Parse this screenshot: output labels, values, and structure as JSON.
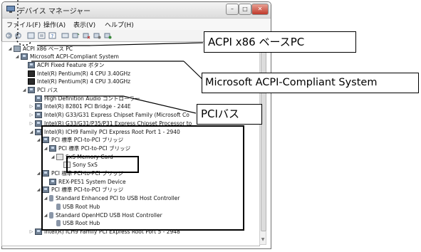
{
  "window": {
    "title": "デバイス マネージャー",
    "controls": {
      "minimize": "–",
      "maximize": "□",
      "close": "✕"
    }
  },
  "menu": {
    "items": [
      "ファイル(F)",
      "操作(A)",
      "表示(V)",
      "ヘルプ(H)"
    ]
  },
  "toolbar": {
    "icons": [
      "back-icon",
      "forward-icon",
      "view-icon",
      "properties-icon",
      "help-icon",
      "scan-icon",
      "update-driver-icon",
      "uninstall-icon",
      "disable-icon",
      "enable-icon"
    ]
  },
  "tree": {
    "nodes": [
      {
        "label": "ACPI x86 ベース PC",
        "indent": 0,
        "expander": "◢",
        "icon": "computer-icon"
      },
      {
        "label": "Microsoft ACPI-Compliant System",
        "indent": 1,
        "expander": "◢",
        "icon": "device-icon"
      },
      {
        "label": "ACPI Fixed Feature ボタン",
        "indent": 2,
        "expander": "",
        "icon": "device-icon"
      },
      {
        "label": "Intel(R) Pentium(R) 4 CPU 3.40GHz",
        "indent": 2,
        "expander": "",
        "icon": "cpu-icon"
      },
      {
        "label": "Intel(R) Pentium(R) 4 CPU 3.40GHz",
        "indent": 2,
        "expander": "",
        "icon": "cpu-icon"
      },
      {
        "label": "PCI バス",
        "indent": 2,
        "expander": "◢",
        "icon": "device-icon"
      },
      {
        "label": "High Definition Audio コントローラー",
        "indent": 3,
        "expander": "",
        "icon": "device-icon"
      },
      {
        "label": "Intel(R) 82801 PCI Bridge - 244E",
        "indent": 3,
        "expander": "▷",
        "icon": "device-icon"
      },
      {
        "label": "Intel(R) G33/G31 Express Chipset Family (Microsoft Co",
        "indent": 3,
        "expander": "▷",
        "icon": "device-icon"
      },
      {
        "label": "Intel(R) G33/G31/P35/P31 Express Chipset Processor to",
        "indent": 3,
        "expander": "▷",
        "icon": "device-icon"
      },
      {
        "label": "Intel(R) ICH9 Family PCI Express Root Port 1 - 2940",
        "indent": 3,
        "expander": "◢",
        "icon": "device-icon"
      },
      {
        "label": "PCI 標準 PCI-to-PCI ブリッジ",
        "indent": 4,
        "expander": "◢",
        "icon": "device-icon"
      },
      {
        "label": "PCI 標準 PCI-to-PCI ブリッジ",
        "indent": 5,
        "expander": "◢",
        "icon": "device-icon"
      },
      {
        "label": "SxS Memory Card",
        "indent": 6,
        "expander": "◢",
        "icon": "card-icon"
      },
      {
        "label": "Sony SxS",
        "indent": 7,
        "expander": "",
        "icon": "card-icon"
      },
      {
        "label": "PCI 標準 PCI-to-PCI ブリッジ",
        "indent": 4,
        "expander": "◢",
        "icon": "device-icon"
      },
      {
        "label": "REX-PE51 System Device",
        "indent": 5,
        "expander": "",
        "icon": "device-icon"
      },
      {
        "label": "PCI 標準 PCI-to-PCI ブリッジ",
        "indent": 4,
        "expander": "◢",
        "icon": "device-icon"
      },
      {
        "label": "Standard Enhanced PCI to USB Host Controller",
        "indent": 5,
        "expander": "◢",
        "icon": "usb-icon"
      },
      {
        "label": "USB Root Hub",
        "indent": 6,
        "expander": "",
        "icon": "usb-icon"
      },
      {
        "label": "Standard OpenHCD USB Host Controller",
        "indent": 5,
        "expander": "◢",
        "icon": "usb-icon"
      },
      {
        "label": "USB Root Hub",
        "indent": 6,
        "expander": "",
        "icon": "usb-icon"
      },
      {
        "label": "Intel(R) ICH9 Family PCI Express Root Port 5 - 2948",
        "indent": 3,
        "expander": "▷",
        "icon": "device-icon"
      }
    ]
  },
  "callouts": {
    "acpi_pc": "ACPI x86 ベースPC",
    "acpi_system": "Microsoft ACPI-Compliant System",
    "pci_bus": "PCIバス"
  }
}
